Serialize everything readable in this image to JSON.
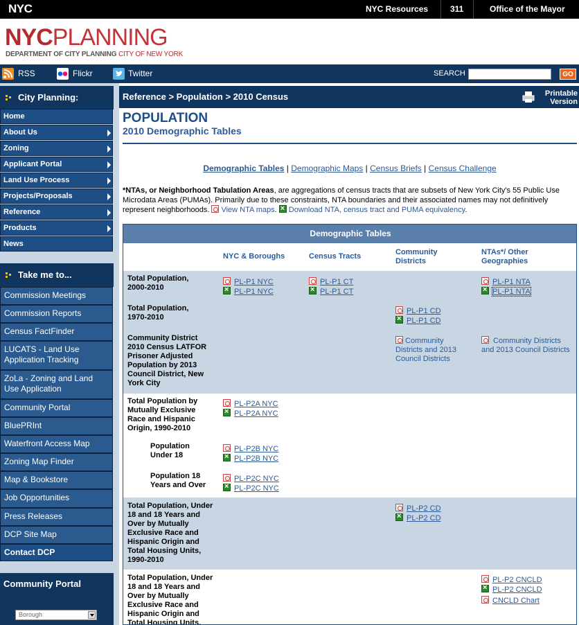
{
  "topbar": {
    "logo": "NYC",
    "links": [
      "NYC Resources",
      "311",
      "Office of the Mayor"
    ]
  },
  "banner": {
    "logo_bold": "NYC",
    "logo_light": "PLANNING",
    "sub_left": "DEPARTMENT OF CITY PLANNING",
    "sub_right": "CITY OF NEW YORK"
  },
  "social": {
    "rss": "RSS",
    "flickr": "Flickr",
    "twitter": "Twitter",
    "search_label": "SEARCH",
    "search_value": "",
    "go": "GO"
  },
  "sidebar": {
    "city_planning_title": "City Planning:",
    "nav": [
      {
        "label": "Home",
        "arrow": false
      },
      {
        "label": "About Us",
        "arrow": true
      },
      {
        "label": "Zoning",
        "arrow": true
      },
      {
        "label": "Applicant Portal",
        "arrow": true
      },
      {
        "label": "Land Use Process",
        "arrow": true
      },
      {
        "label": "Projects/Proposals",
        "arrow": true
      },
      {
        "label": "Reference",
        "arrow": true
      },
      {
        "label": "Products",
        "arrow": true
      },
      {
        "label": "News",
        "arrow": false
      }
    ],
    "take_me_title": "Take me to...",
    "take_me": [
      "Commission Meetings",
      "Commission Reports",
      "Census FactFinder",
      "LUCATS - Land Use Application Tracking",
      "ZoLa - Zoning and Land Use Application",
      "Community Portal",
      "BluePRInt",
      "Waterfront Access Map",
      "Zoning Map Finder",
      "Map & Bookstore",
      "Job Opportunities",
      "Press Releases",
      "DCP Site Map",
      "Contact DCP"
    ],
    "community_portal_title": "Community  Portal",
    "borough_select": "Borough"
  },
  "main": {
    "breadcrumb": "Reference > Population > 2010 Census",
    "printable": "Printable Version",
    "title": "POPULATION",
    "subtitle": "2010 Demographic Tables",
    "tabs": [
      "Demographic Tables",
      "Demographic Maps",
      "Census Briefs",
      "Census Challenge"
    ],
    "intro_bold": "*NTAs, or Neighborhood Tabulation Areas",
    "intro_text": ", are aggregations of census tracts that are subsets of New York City's 55 Public Use Microdata Areas (PUMAs). Primarily due to these constraints, NTA boundaries and their associated names may not definitively represent neighborhoods.",
    "intro_link1": "View NTA maps",
    "intro_link2": "Download NTA, census tract and PUMA equivalency",
    "table": {
      "caption": "Demographic Tables",
      "columns": [
        "NYC & Boroughs",
        "Census Tracts",
        "Community Districts",
        "NTAs*/ Other Geographies"
      ],
      "rows": [
        {
          "label": "Total Population, 2000-2010",
          "nyc": [
            "PL-P1 NYC",
            "PL-P1 NYC"
          ],
          "ct": [
            "PL-P1 CT",
            "PL-P1 CT"
          ],
          "cd": [],
          "nta": [
            "PL-P1 NTA",
            "PL-P1 NTA"
          ]
        },
        {
          "label": "Total Population, 1970-2010",
          "nyc": [],
          "ct": [],
          "cd": [
            "PL-P1 CD",
            "PL-P1 CD"
          ],
          "nta": []
        },
        {
          "label": "Community District 2010 Census LATFOR Prisoner Adjusted Population by 2013 Council District, New York City",
          "cd_text": "Community Districts and 2013 Council Districts",
          "nta_text": " Community Districts and 2013 Council Districts"
        },
        {
          "label": "Total Population by Mutually Exclusive Race and Hispanic Origin, 1990-2010",
          "nyc": [
            "PL-P2A NYC",
            "PL-P2A NYC"
          ]
        },
        {
          "label": "Population Under 18",
          "nyc": [
            "PL-P2B NYC",
            "PL-P2B NYC"
          ]
        },
        {
          "label": "Population 18 Years and Over",
          "nyc": [
            "PL-P2C NYC",
            "PL-P2C NYC"
          ]
        },
        {
          "label": "Total Population, Under 18 and 18 Years and Over  by Mutually Exclusive Race and Hispanic Origin and Total Housing Units, 1990-2010",
          "cd": [
            "PL-P2 CD",
            "PL-P2 CD"
          ]
        },
        {
          "label": "Total Population, Under 18 and 18 Years and Over  by Mutually Exclusive Race and Hispanic Origin and Total Housing Units,",
          "nta": [
            "PL-P2 CNCLD",
            "PL-P2 CNCLD",
            "CNCLD Chart"
          ]
        }
      ]
    }
  },
  "colors": {
    "navy": "#10355f",
    "blue": "#1e4e86",
    "sidebar_bg": "#c8d5e3",
    "row_alt": "#c8d5e3",
    "go": "#e8671f"
  }
}
